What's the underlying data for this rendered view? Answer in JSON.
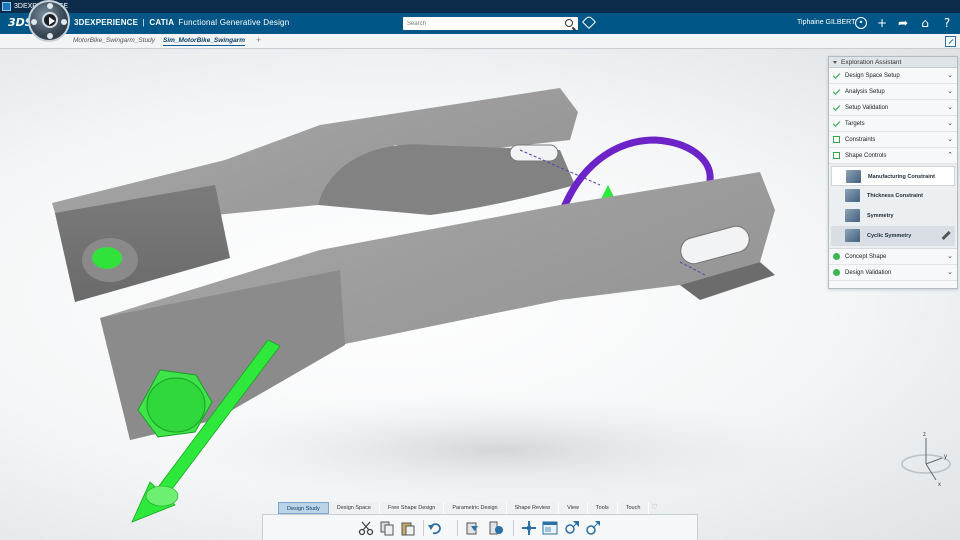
{
  "window": {
    "title": "3DEXPERIENCE"
  },
  "header": {
    "brand": "3DEXPERIENCE",
    "separator": "|",
    "product": "CATIA",
    "app_name": "Functional Generative Design",
    "search_placeholder": "Search",
    "user_name": "Tiphaine GILBERT"
  },
  "tabs": [
    {
      "label": "MotorBike_Swingarm_Study",
      "active": false
    },
    {
      "label": "Sim_MotorBike_Swingarm",
      "active": true
    }
  ],
  "assistant": {
    "title": "Exploration Assistant",
    "steps": [
      {
        "label": "Design Space Setup",
        "status": "done"
      },
      {
        "label": "Analysis Setup",
        "status": "done"
      },
      {
        "label": "Setup Validation",
        "status": "done"
      },
      {
        "label": "Targets",
        "status": "done"
      },
      {
        "label": "Constraints",
        "status": "open"
      },
      {
        "label": "Shape Controls",
        "status": "open",
        "expanded": true
      },
      {
        "label": "Concept Shape",
        "status": "dot"
      },
      {
        "label": "Design Validation",
        "status": "dot"
      }
    ],
    "shape_controls": [
      "Manufacturing Constraint",
      "Thickness Constraint",
      "Symmetry",
      "Cyclic Symmetry"
    ]
  },
  "triad": {
    "x": "x",
    "y": "y",
    "z": "z"
  },
  "action_bar": {
    "tabs": [
      "Design Study",
      "Design Space",
      "Free Shape Design",
      "Parametric Design",
      "Shape Review",
      "View",
      "Tools",
      "Touch"
    ],
    "active_tab": "Design Study"
  },
  "colors": {
    "header_bg": "#005686",
    "model_gray": "#9a9a9a",
    "constraint_green": "#2ee83c",
    "symmetry_purple": "#6c24c8"
  }
}
